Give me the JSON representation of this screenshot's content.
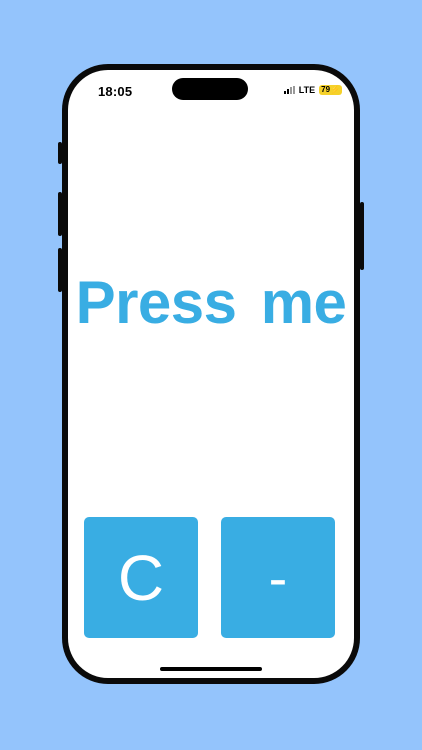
{
  "status_bar": {
    "time": "18:05",
    "network": "LTE",
    "battery": "79"
  },
  "main": {
    "headline": "Press me"
  },
  "buttons": {
    "clear_label": "C",
    "minus_label": "-"
  },
  "colors": {
    "background": "#94c4fc",
    "accent": "#39ade3",
    "battery": "#f5d12a"
  }
}
